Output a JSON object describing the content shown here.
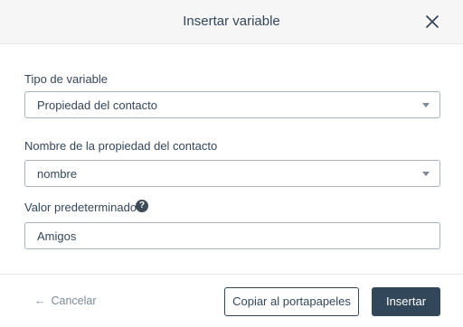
{
  "dialog": {
    "title": "Insertar variable",
    "close_icon": "close-icon"
  },
  "form": {
    "variable_type": {
      "label": "Tipo de variable",
      "selected": "Propiedad del contacto"
    },
    "property_name": {
      "label": "Nombre de la propiedad del contacto",
      "selected": "nombre"
    },
    "default_value": {
      "label": "Valor predeterminado",
      "help_icon": "question-circle-icon",
      "help_glyph": "?",
      "value": "Amigos"
    }
  },
  "footer": {
    "cancel_arrow": "←",
    "cancel_label": "Cancelar",
    "copy_label": "Copiar al portapapeles",
    "insert_label": "Insertar"
  },
  "colors": {
    "primary": "#33475b",
    "border": "#a7b4c1",
    "muted": "#7c8a97",
    "header_bg": "#f6f6f6"
  }
}
